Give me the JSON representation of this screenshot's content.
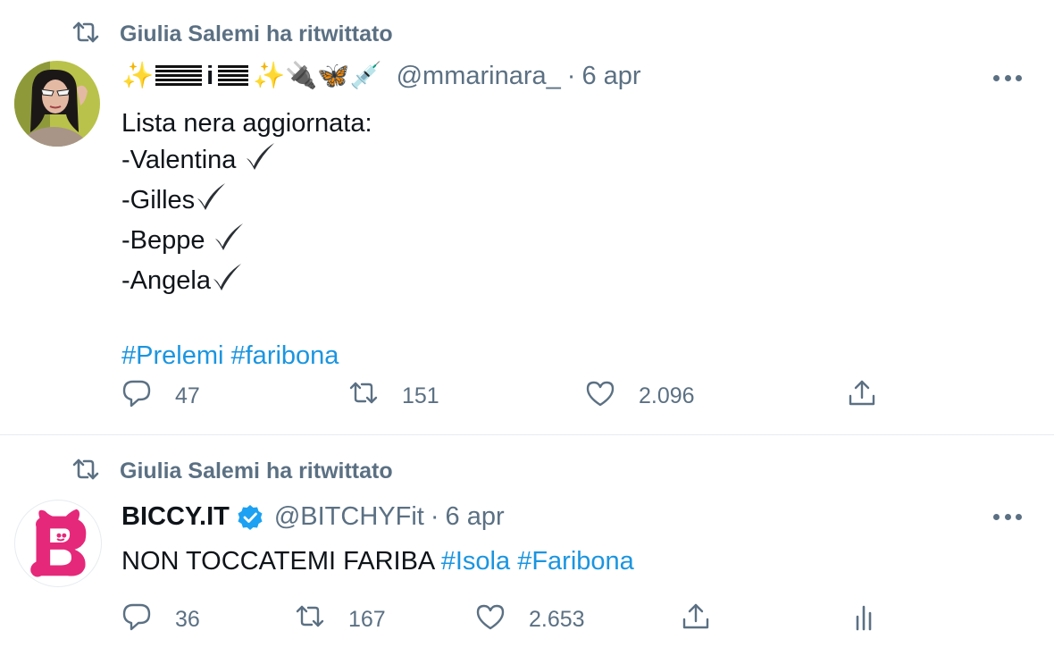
{
  "tweets": [
    {
      "retweeted_by": "Giulia Salemi ha ritwittato",
      "display_name": "✨ 𝄛𝄛𝄛i𝄛𝄛 ✨🔌🦋💉",
      "handle": "@mmarinara_",
      "dot": "·",
      "date": "6 apr",
      "lines": [
        "Lista nera aggiornata:",
        "-Valentina",
        "-Gilles",
        "-Beppe",
        "-Angela"
      ],
      "hashtags": [
        "#Prelemi",
        "#faribona"
      ],
      "replies": "47",
      "retweets": "151",
      "likes": "2.096",
      "icons": {
        "retweet": "retweet-icon",
        "reply": "reply-icon",
        "like": "heart-icon",
        "share": "share-icon",
        "more": "more-icon",
        "check": "check-mark-icon"
      }
    },
    {
      "retweeted_by": "Giulia Salemi ha ritwittato",
      "display_name": "BICCY.IT",
      "verified": true,
      "handle": "@BITCHYFit",
      "dot": "·",
      "date": "6 apr",
      "text": "NON TOCCATEMI FARIBA",
      "hashtags": [
        "#Isola",
        "#Faribona"
      ],
      "replies": "36",
      "retweets": "167",
      "likes": "2.653",
      "icons": {
        "retweet": "retweet-icon",
        "reply": "reply-icon",
        "like": "heart-icon",
        "share": "share-icon",
        "analytics": "analytics-icon",
        "more": "more-icon",
        "verified": "verified-badge-icon"
      }
    }
  ],
  "colors": {
    "link": "#1b95e0",
    "secondary": "#5b7083",
    "verified": "#1da1f2",
    "divider": "#e6ecf0"
  }
}
